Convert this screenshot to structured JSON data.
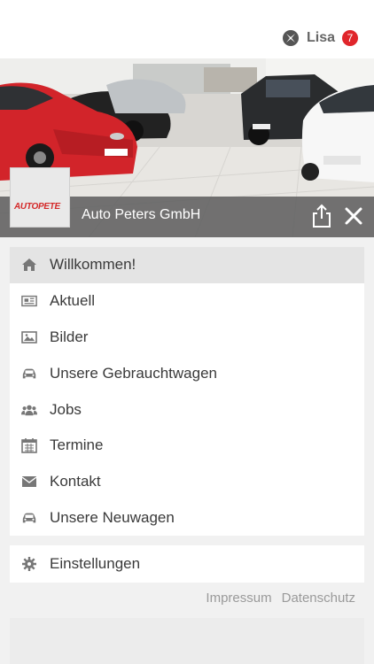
{
  "user": {
    "name": "Lisa",
    "notification_count": "7",
    "badge_color": "#e0262b"
  },
  "hero": {
    "company_name": "Auto Peters GmbH",
    "logo_text": "AUTOPETE"
  },
  "menu": {
    "items": [
      {
        "label": "Willkommen!",
        "icon": "home-icon"
      },
      {
        "label": "Aktuell",
        "icon": "newspaper-icon"
      },
      {
        "label": "Bilder",
        "icon": "image-icon"
      },
      {
        "label": "Unsere Gebrauchtwagen",
        "icon": "car-icon"
      },
      {
        "label": "Jobs",
        "icon": "users-icon"
      },
      {
        "label": "Termine",
        "icon": "calendar-icon"
      },
      {
        "label": "Kontakt",
        "icon": "envelope-icon"
      },
      {
        "label": "Unsere Neuwagen",
        "icon": "car-icon"
      }
    ],
    "settings_label": "Einstellungen"
  },
  "footer": {
    "impressum": "Impressum",
    "datenschutz": "Datenschutz"
  },
  "colors": {
    "accent_red": "#e0262b",
    "overlay_gray": "#606060",
    "background": "#f1f1f1"
  }
}
